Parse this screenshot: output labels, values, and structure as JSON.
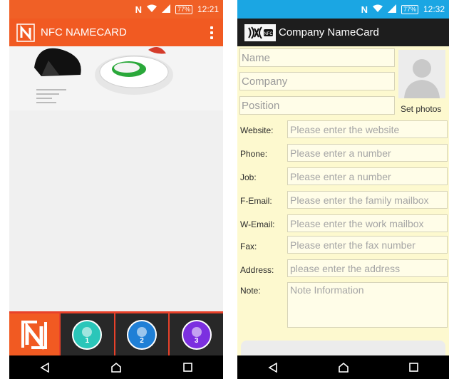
{
  "left": {
    "status": {
      "nfc": "N",
      "wifi": "wifi-icon",
      "signal": "signal-icon",
      "battery": "77%",
      "time": "12:21"
    },
    "appbar": {
      "title": "NFC NAMECARD"
    },
    "bottom_tabs": [
      {
        "label": "1",
        "color": "#2ac6b9"
      },
      {
        "label": "2",
        "color": "#1f7fd6"
      },
      {
        "label": "3",
        "color": "#7c2fe0"
      }
    ],
    "colors": {
      "accent": "#f15a22",
      "status_bar": "#f06026"
    }
  },
  "right": {
    "status": {
      "nfc": "N",
      "wifi": "wifi-icon",
      "signal": "signal-icon",
      "battery": "77%",
      "time": "12:32"
    },
    "appbar": {
      "title": "Company NameCard"
    },
    "top_fields": [
      {
        "placeholder": "Name"
      },
      {
        "placeholder": "Company"
      },
      {
        "placeholder": "Position"
      }
    ],
    "set_photos": "Set photos",
    "rows": [
      {
        "label": "Website:",
        "placeholder": "Please enter the website"
      },
      {
        "label": "Phone:",
        "placeholder": "Please enter a number"
      },
      {
        "label": "Job:",
        "placeholder": "Please enter a number"
      },
      {
        "label": "F-Email:",
        "placeholder": "Please enter the family mailbox"
      },
      {
        "label": "W-Email:",
        "placeholder": "Please enter the work mailbox"
      },
      {
        "label": "Fax:",
        "placeholder": "Please enter the fax number"
      },
      {
        "label": "Address:",
        "placeholder": "please enter the address"
      },
      {
        "label": "Note:",
        "placeholder": "Note Information"
      }
    ],
    "colors": {
      "background": "#fdf9cf",
      "status_bar": "#1ba6e3",
      "app_bar": "#1d1d1d"
    }
  }
}
